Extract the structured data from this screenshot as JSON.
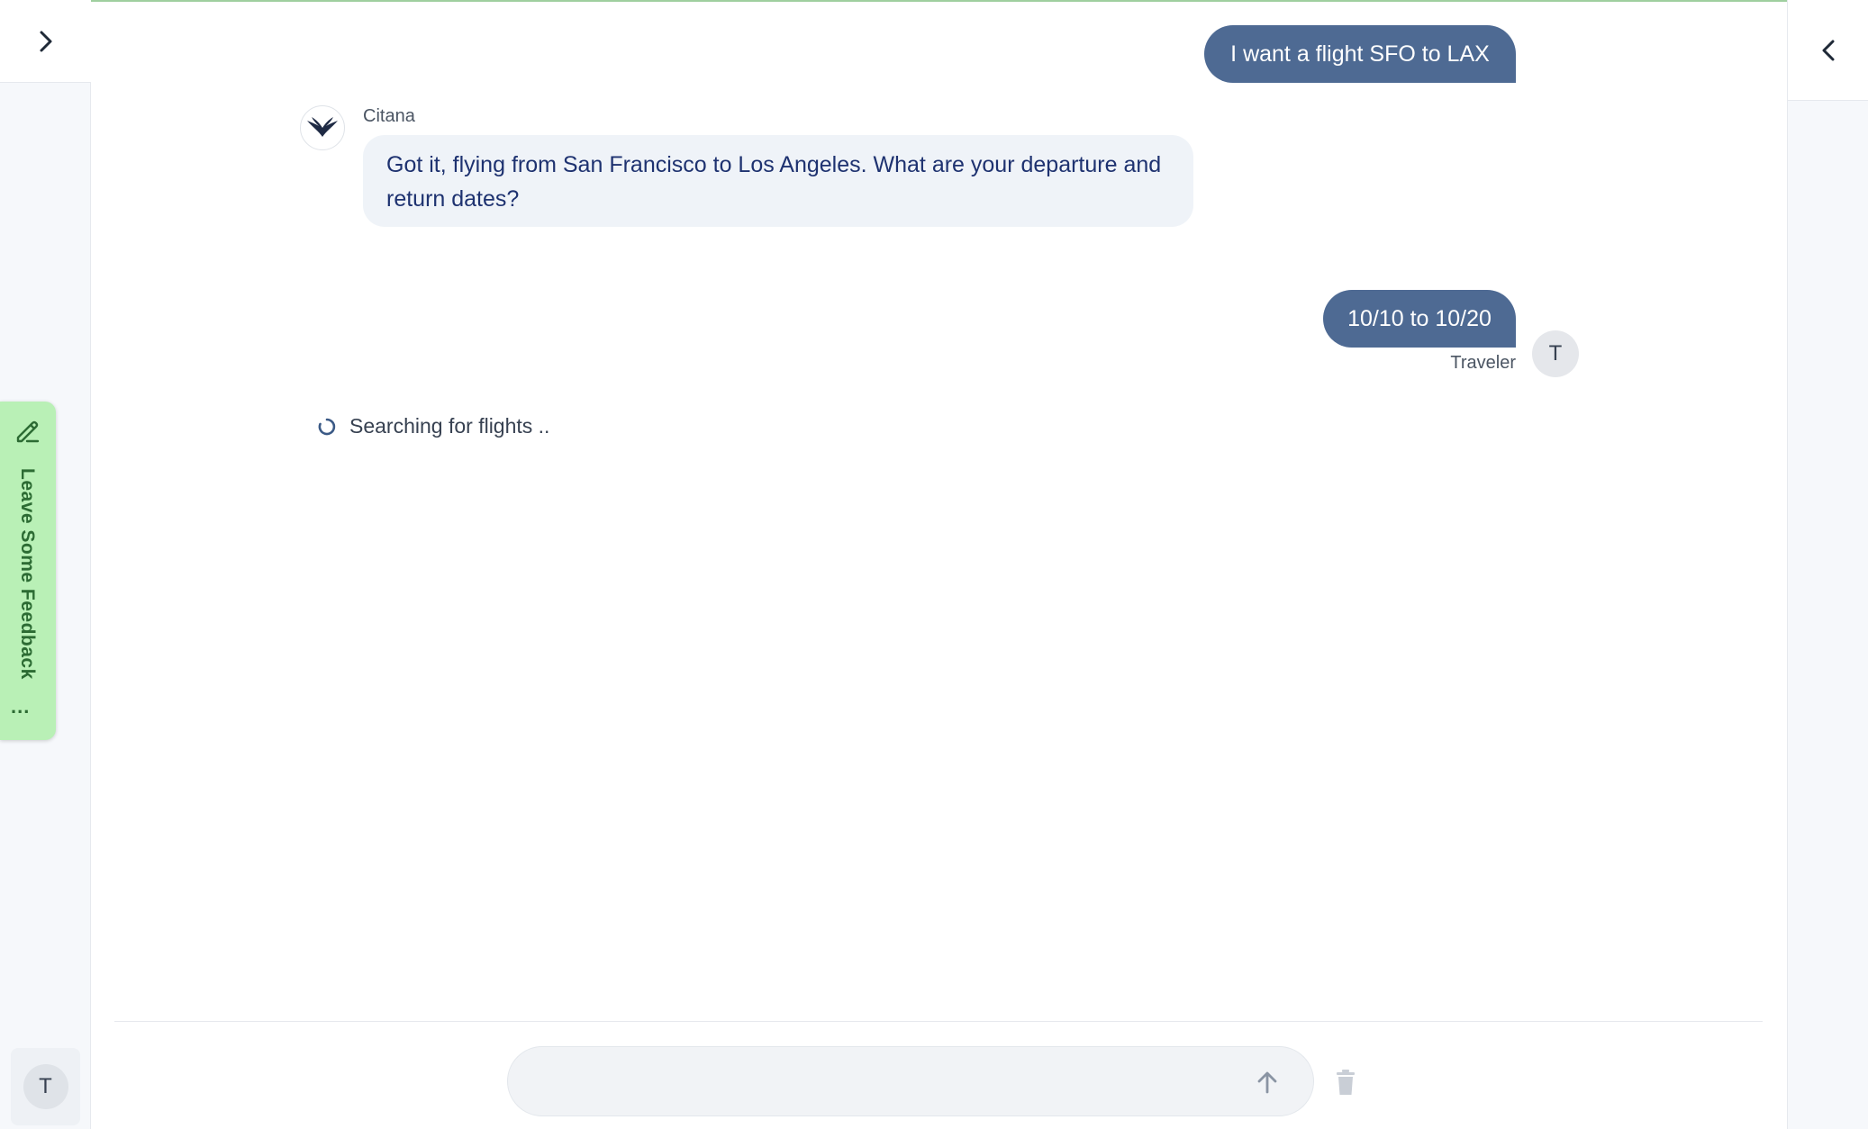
{
  "left_sidebar": {
    "expand_icon": "chevron-right-icon",
    "user_avatar_initial": "T"
  },
  "feedback_tab": {
    "label": "Leave Some Feedback",
    "more": "...",
    "icon": "pen-icon",
    "color": "#b9f0b6"
  },
  "right_sidebar": {
    "collapse_icon": "chevron-left-icon"
  },
  "conversation": {
    "messages": [
      {
        "role": "user",
        "text": "I want a flight SFO to LAX"
      },
      {
        "role": "assistant",
        "sender": "Citana",
        "text": "Got it, flying from San Francisco to Los Angeles. What are your departure and return dates?"
      },
      {
        "role": "user",
        "sender": "Traveler",
        "avatar_initial": "T",
        "text": "10/10 to 10/20"
      }
    ],
    "status": "Searching for flights  .."
  },
  "composer": {
    "value": "",
    "send_icon": "arrow-up-icon",
    "delete_icon": "trash-icon"
  },
  "colors": {
    "user_bubble": "#4e6a93",
    "assistant_bubble": "#eff3f8",
    "assistant_text": "#1e3270"
  }
}
